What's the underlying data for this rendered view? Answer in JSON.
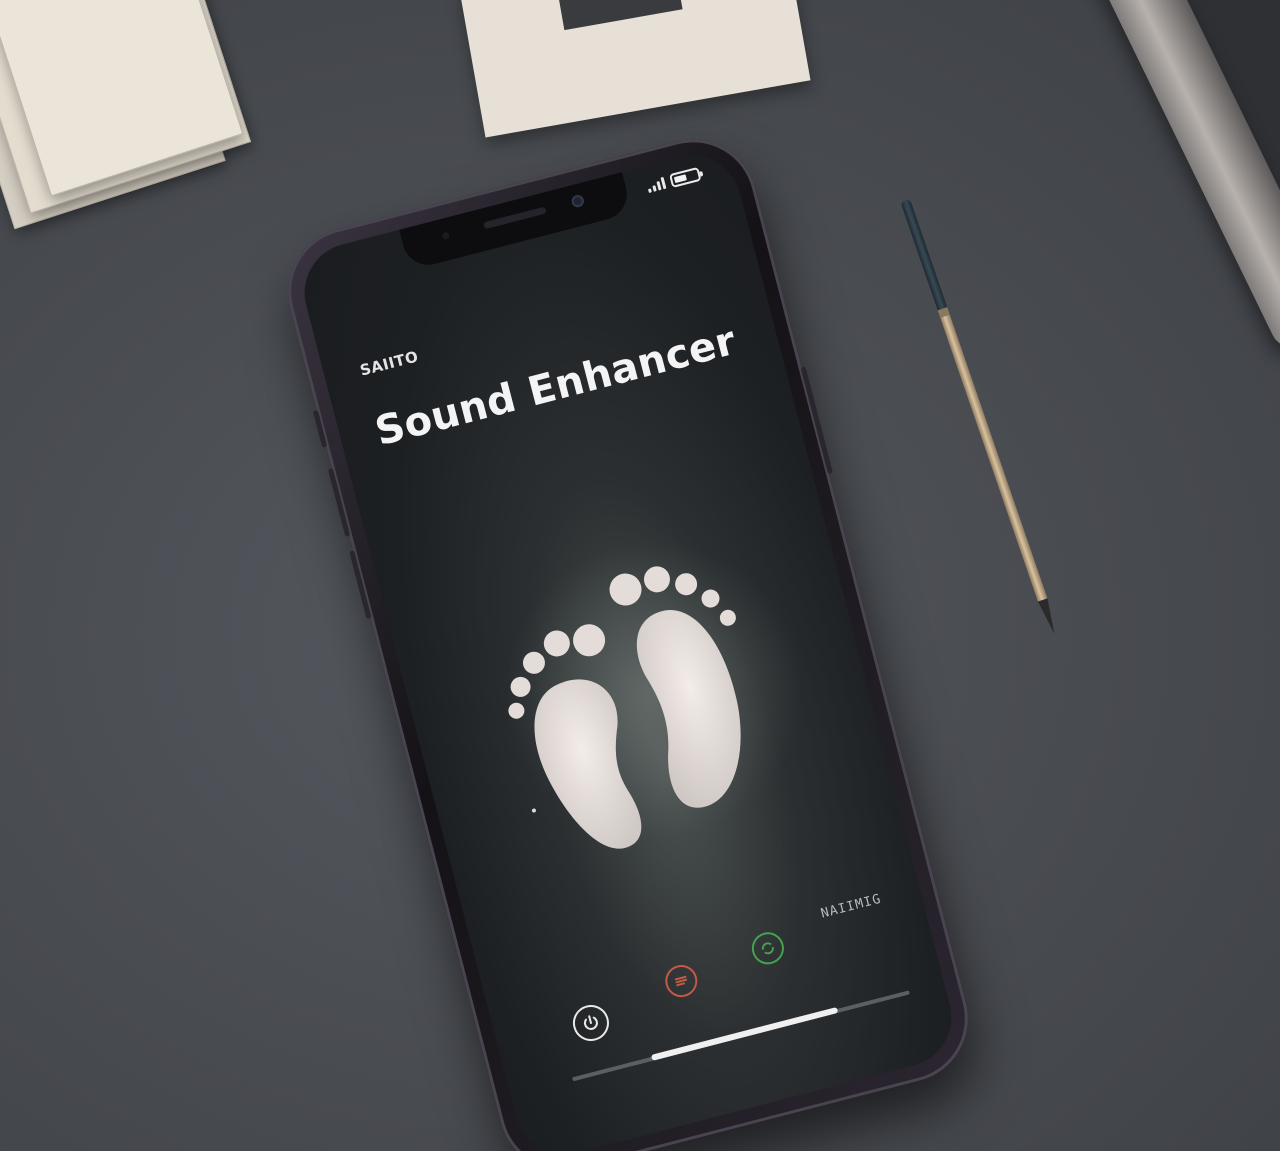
{
  "app": {
    "label": "SAIITO",
    "title": "Sound Enhancer"
  },
  "status_bar": {
    "battery_level": 0.55
  },
  "screen": {
    "corner_text": "NAIIMIG",
    "progress": 0.72
  },
  "controls": {
    "power_icon": "power-icon",
    "red_icon": "red-settings-icon",
    "green_icon": "green-sync-icon",
    "colors": {
      "red": "#c25a45",
      "green": "#43a34e"
    }
  },
  "artwork": {
    "icon": "footprints-icon"
  }
}
